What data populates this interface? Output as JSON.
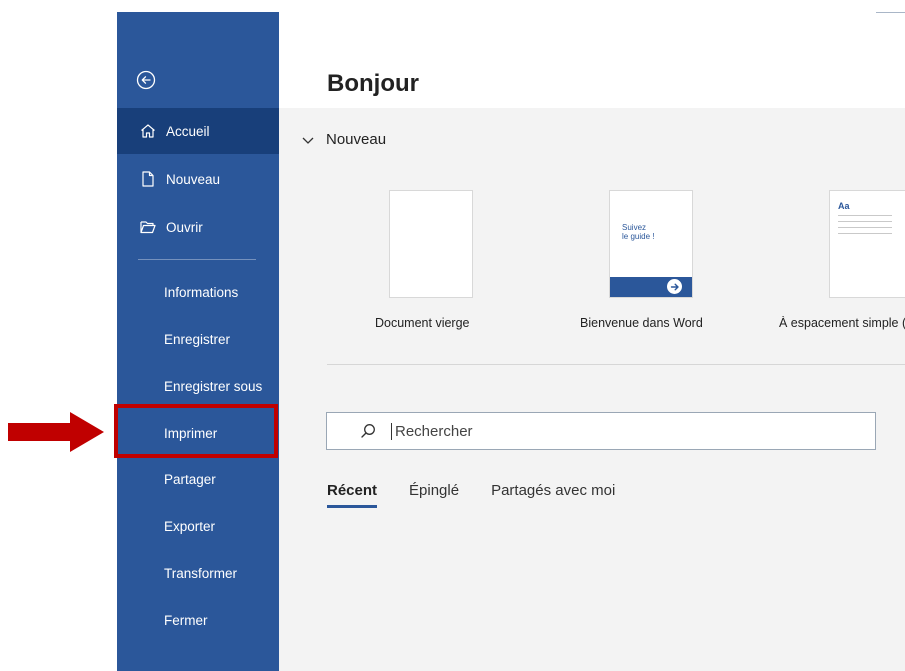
{
  "sidebar": {
    "primary": [
      {
        "label": "Accueil",
        "icon": "home-icon"
      },
      {
        "label": "Nouveau",
        "icon": "new-document-icon"
      },
      {
        "label": "Ouvrir",
        "icon": "open-folder-icon"
      }
    ],
    "secondary": [
      {
        "label": "Informations"
      },
      {
        "label": "Enregistrer"
      },
      {
        "label": "Enregistrer sous"
      },
      {
        "label": "Imprimer"
      },
      {
        "label": "Partager"
      },
      {
        "label": "Exporter"
      },
      {
        "label": "Transformer"
      },
      {
        "label": "Fermer"
      }
    ]
  },
  "main": {
    "title": "Bonjour",
    "new_section": {
      "label": "Nouveau",
      "templates": [
        {
          "label": "Document vierge"
        },
        {
          "label": "Bienvenue dans Word",
          "thumb_text_1": "Suivez",
          "thumb_text_2": "le guide !"
        },
        {
          "label": "À espacement simple (vierge)",
          "thumb_text": "Aa"
        }
      ]
    },
    "search": {
      "placeholder": "Rechercher"
    },
    "tabs": [
      {
        "label": "Récent"
      },
      {
        "label": "Épinglé"
      },
      {
        "label": "Partagés avec moi"
      }
    ]
  },
  "colors": {
    "sidebar_bg": "#2b579a",
    "sidebar_active": "#183f7a",
    "callout": "#c00000"
  }
}
